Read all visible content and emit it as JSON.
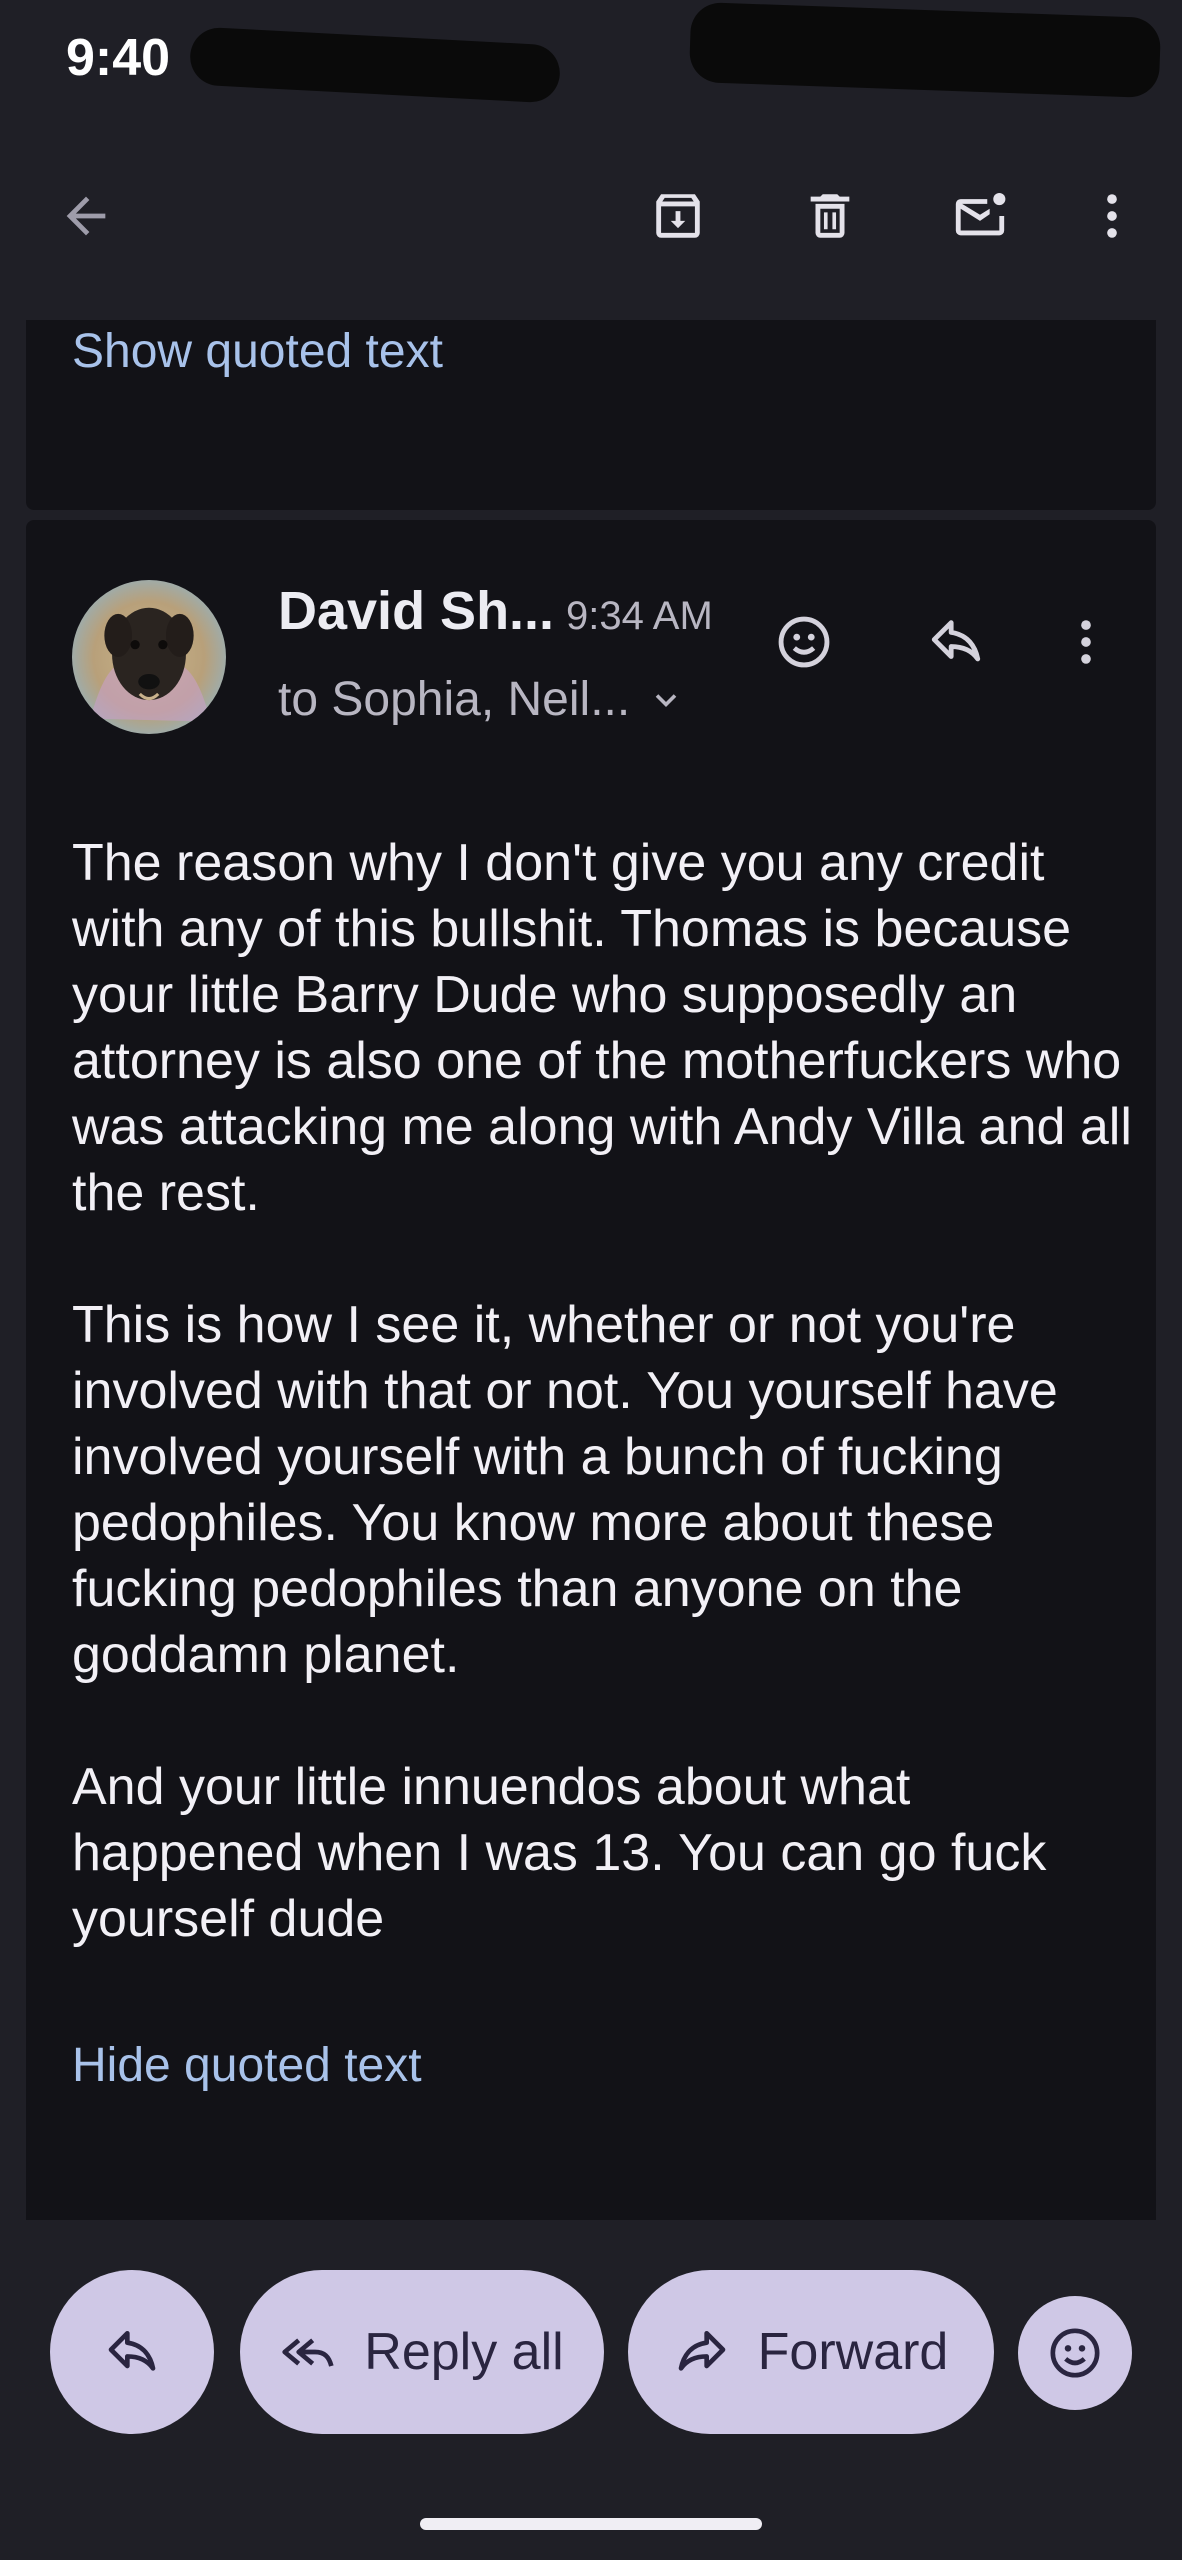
{
  "status_bar": {
    "time": "9:40"
  },
  "app_bar": {
    "back_icon": "arrow-back-icon",
    "archive_icon": "archive-icon",
    "delete_icon": "trash-icon",
    "mark_unread_icon": "mark-unread-icon",
    "more_icon": "more-vert-icon"
  },
  "quoted_top": {
    "show_quoted_text": "Show quoted text"
  },
  "message": {
    "sender": "David Sh...",
    "time": "9:34 AM",
    "recipients": "to Sophia, Neil...",
    "paragraphs": [
      "The reason why I don't give you any credit with any of this bullshit. Thomas is because your little Barry Dude who supposedly an attorney is also one of the motherfuckers who was attacking me along with Andy Villa and all the rest.",
      "This is how I see it, whether or not you're involved with that or not. You yourself have involved yourself with a bunch of fucking pedophiles. You know more about these fucking pedophiles than anyone on the goddamn planet.",
      "And your little innuendos about what happened when I was 13. You can go fuck yourself dude"
    ],
    "hide_quoted_text": "Hide quoted text"
  },
  "actions": {
    "reply_all_label": "Reply all",
    "forward_label": "Forward"
  },
  "colors": {
    "background": "#1f1f26",
    "card": "#121217",
    "link": "#a8c2ea",
    "pill": "#cfc8e6"
  }
}
